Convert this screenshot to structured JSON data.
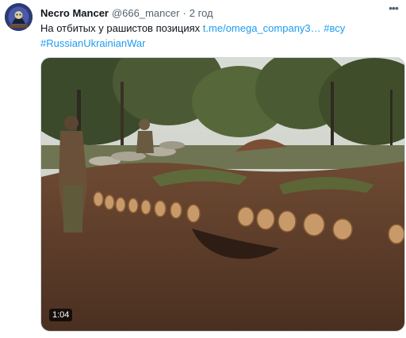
{
  "tweet": {
    "author_name": "Necro Mancer",
    "handle": "@666_mancer",
    "separator": "·",
    "time": "2 год",
    "text_plain": "На отбитых у рашистов позициях",
    "link": "t.me/omega_company3…",
    "hashtag_1": "#всу",
    "hashtag_2": "#RussianUkrainianWar"
  },
  "media": {
    "type": "video",
    "duration": "1:04"
  },
  "icons": {
    "more": "more-dots-icon",
    "avatar": "avatar-image"
  },
  "colors": {
    "link": "#1d9bf0",
    "name": "#0f1419",
    "secondary": "#536471"
  }
}
